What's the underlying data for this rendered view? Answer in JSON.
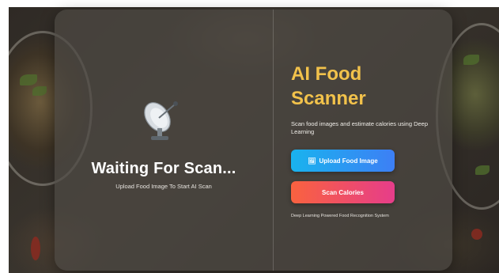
{
  "status": {
    "title": "Waiting For Scan...",
    "subtitle": "Upload Food Image To Start AI Scan",
    "icon": "satellite-dish-icon"
  },
  "app": {
    "title_line1": "AI Food",
    "title_line2": "Scanner",
    "description": "Scan food images and estimate calories using Deep Learning",
    "footer": "Deep Learning Powered Food Recognition System"
  },
  "actions": {
    "upload_label": "Upload Food Image",
    "upload_icon": "🖼",
    "scan_label": "Scan Calories"
  },
  "colors": {
    "accent_title": "#f2c24b",
    "upload_gradient": [
      "#19b3ee",
      "#3d7ff5"
    ],
    "scan_gradient": [
      "#f9623f",
      "#e63d8a"
    ]
  }
}
